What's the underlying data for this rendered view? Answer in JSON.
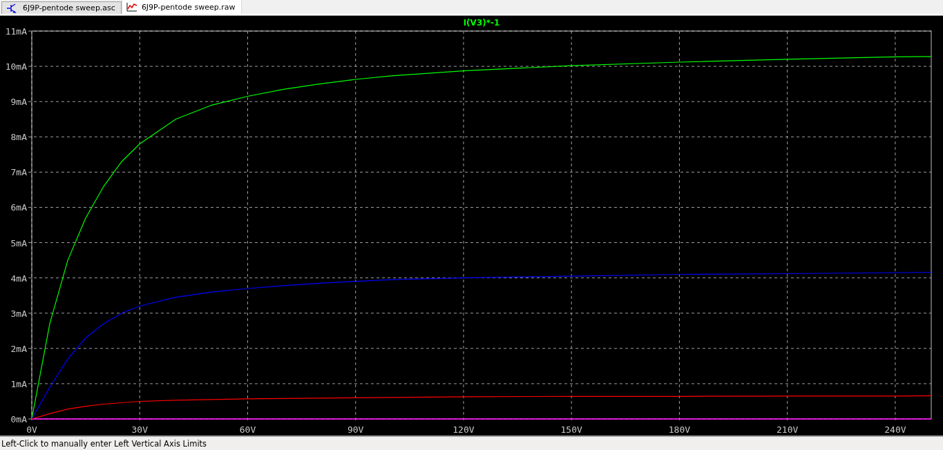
{
  "tabs": [
    {
      "label": "6J9P-pentode sweep.asc",
      "kind": "schematic",
      "selected": false
    },
    {
      "label": "6J9P-pentode sweep.raw",
      "kind": "waveform",
      "selected": true
    }
  ],
  "plot": {
    "chart_data": {
      "type": "line",
      "title": "I(V3)*-1",
      "x": [
        0,
        5,
        10,
        15,
        20,
        25,
        30,
        40,
        50,
        60,
        70,
        80,
        90,
        100,
        120,
        150,
        180,
        210,
        240,
        250
      ],
      "series": [
        {
          "color": "#00ff00",
          "values": [
            0,
            2.7,
            4.5,
            5.7,
            6.6,
            7.3,
            7.8,
            8.5,
            8.9,
            9.15,
            9.35,
            9.5,
            9.63,
            9.73,
            9.87,
            10.02,
            10.12,
            10.2,
            10.27,
            10.28
          ]
        },
        {
          "color": "#0000ff",
          "values": [
            0,
            0.9,
            1.7,
            2.3,
            2.7,
            3.0,
            3.2,
            3.45,
            3.6,
            3.7,
            3.78,
            3.85,
            3.9,
            3.95,
            4.0,
            4.05,
            4.1,
            4.12,
            4.15,
            4.16
          ]
        },
        {
          "color": "#ff0000",
          "values": [
            0,
            0.15,
            0.28,
            0.36,
            0.42,
            0.46,
            0.5,
            0.53,
            0.55,
            0.57,
            0.58,
            0.59,
            0.6,
            0.61,
            0.63,
            0.64,
            0.64,
            0.65,
            0.65,
            0.66
          ]
        }
      ],
      "grid": true,
      "xlim": [
        0,
        250
      ],
      "ylim": [
        0,
        11
      ],
      "xticks": [
        {
          "value": 0,
          "label": "0V"
        },
        {
          "value": 30,
          "label": "30V"
        },
        {
          "value": 60,
          "label": "60V"
        },
        {
          "value": 90,
          "label": "90V"
        },
        {
          "value": 120,
          "label": "120V"
        },
        {
          "value": 150,
          "label": "150V"
        },
        {
          "value": 180,
          "label": "180V"
        },
        {
          "value": 210,
          "label": "210V"
        },
        {
          "value": 240,
          "label": "240V"
        }
      ],
      "yticks": [
        {
          "value": 0,
          "label": "0mA"
        },
        {
          "value": 1,
          "label": "1mA"
        },
        {
          "value": 2,
          "label": "2mA"
        },
        {
          "value": 3,
          "label": "3mA"
        },
        {
          "value": 4,
          "label": "4mA"
        },
        {
          "value": 5,
          "label": "5mA"
        },
        {
          "value": 6,
          "label": "6mA"
        },
        {
          "value": 7,
          "label": "7mA"
        },
        {
          "value": 8,
          "label": "8mA"
        },
        {
          "value": 9,
          "label": "9mA"
        },
        {
          "value": 10,
          "label": "10mA"
        },
        {
          "value": 11,
          "label": "11mA"
        }
      ]
    }
  },
  "status_bar": "Left-Click to manually enter Left Vertical Axis Limits"
}
